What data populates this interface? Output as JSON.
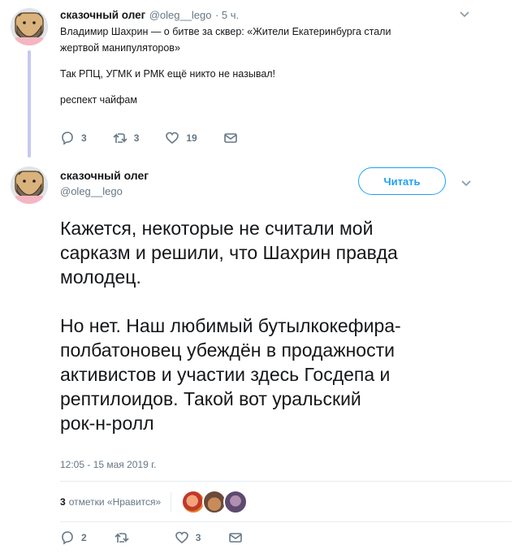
{
  "colors": {
    "accent": "#1da1f2",
    "thread_line": "#c6c9f3",
    "muted": "#657786"
  },
  "reply_tweet": {
    "name": "сказочный олег",
    "handle": "@oleg__lego",
    "time": "· 5 ч.",
    "lines": [
      "Владимир Шахрин — о битве за сквер: «Жители Екатеринбурга стали",
      "жертвой манипуляторов»"
    ],
    "line2": "Так РПЦ, УГМК и РМК ещё никто не называл!",
    "line3": "респект чайфам",
    "replies": "3",
    "retweets": "3",
    "likes": "19"
  },
  "main_tweet": {
    "name": "сказочный олег",
    "handle": "@oleg__lego",
    "follow_label": "Читать",
    "para1": [
      "Кажется, некоторые не считали мой",
      "сарказм и решили, что Шахрин правда",
      "молодец."
    ],
    "para2": [
      "Но нет. Наш любимый бутылкокефира-",
      "полбатоновец убеждён в продажности",
      "активистов и участии здесь Госдепа и",
      "рептилоидов. Такой вот уральский",
      "рок-н-ролл"
    ],
    "timestamp": "12:05 - 15 мая 2019 г.",
    "likes_count": "3",
    "likes_label": "отметки «Нравится»",
    "replies": "2",
    "retweets": "",
    "likes": "3"
  },
  "icons": [
    "reply-icon",
    "retweet-icon",
    "heart-icon",
    "mail-icon",
    "chevron-down-icon"
  ]
}
